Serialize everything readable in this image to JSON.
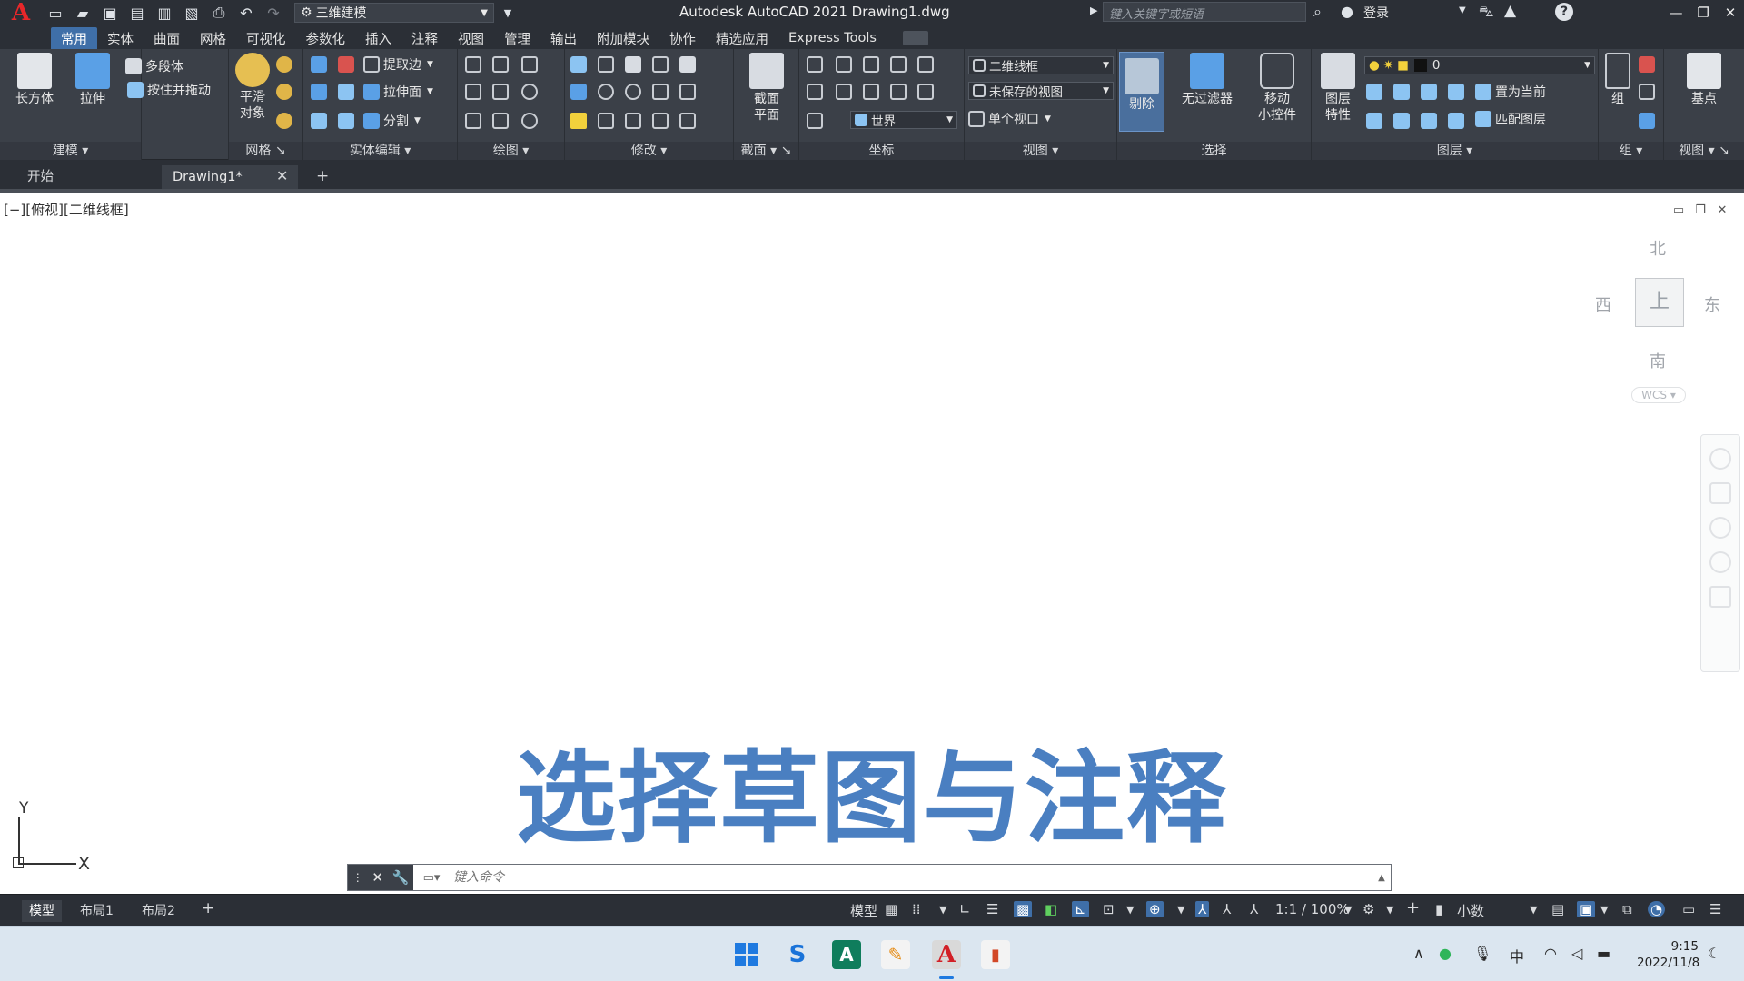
{
  "app": {
    "logo": "A",
    "title": "Autodesk AutoCAD 2021    Drawing1.dwg",
    "workspace": "三维建模",
    "search_placeholder": "键入关键字或短语",
    "login": "登录"
  },
  "ribbon_tabs": [
    "常用",
    "实体",
    "曲面",
    "网格",
    "可视化",
    "参数化",
    "插入",
    "注释",
    "视图",
    "管理",
    "输出",
    "附加模块",
    "协作",
    "精选应用",
    "Express Tools"
  ],
  "panels": {
    "modeling": {
      "title": "建模",
      "box": "长方体",
      "extrude": "拉伸",
      "polysolid": "多段体",
      "presspull": "按住并拖动"
    },
    "mesh": {
      "title": "网格",
      "smooth": "平滑\n对象"
    },
    "solid_edit": {
      "title": "实体编辑",
      "extract_edges": "提取边",
      "extrude_faces": "拉伸面",
      "separate": "分割"
    },
    "draw": {
      "title": "绘图"
    },
    "modify": {
      "title": "修改"
    },
    "section": {
      "title": "截面",
      "section_plane": "截面\n平面"
    },
    "coordinates": {
      "title": "坐标",
      "world": "世界"
    },
    "view": {
      "title": "视图",
      "visual_style": "二维线框",
      "named_view": "未保存的视图",
      "viewport": "单个视口"
    },
    "selection": {
      "title": "选择",
      "cull": "剔除",
      "no_filter": "无过滤器",
      "gizmo": "移动\n小控件"
    },
    "layers": {
      "title": "图层",
      "layer_props": "图层\n特性",
      "current_layer": "0",
      "set_current": "置为当前",
      "match_layer": "匹配图层"
    },
    "groups": {
      "title": "组",
      "group": "组"
    },
    "view2": {
      "title": "视图",
      "base": "基点"
    }
  },
  "doc_tabs": {
    "start": "开始",
    "drawing": "Drawing1*"
  },
  "canvas": {
    "viewport_label": "[−][俯视][二维线框]",
    "viewcube": {
      "north": "北",
      "south": "南",
      "east": "东",
      "west": "西",
      "top": "上",
      "wcs": "WCS ▾"
    },
    "ucs": {
      "x": "X",
      "y": "Y"
    },
    "caption": "选择草图与注释"
  },
  "command_line": {
    "placeholder": "键入命令"
  },
  "status_bar": {
    "layouts": [
      "模型",
      "布局1",
      "布局2"
    ],
    "model": "模型",
    "scale": "1:1 / 100%",
    "units": "小数"
  },
  "taskbar": {
    "time": "9:15",
    "date": "2022/11/8"
  }
}
